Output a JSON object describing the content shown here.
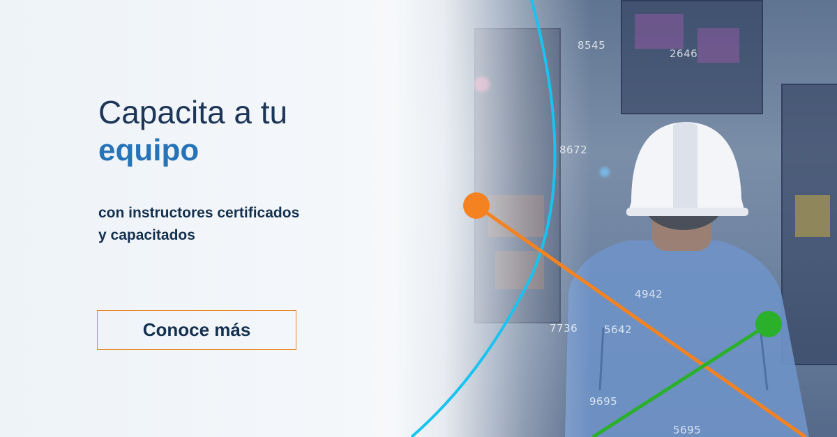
{
  "headline": {
    "line1": "Capacita a tu",
    "line2": "equipo"
  },
  "subheading": {
    "line1": "con instructores certificados",
    "line2": "y capacitados"
  },
  "cta": {
    "label": "Conoce más"
  },
  "photo_numbers": [
    "8545",
    "2646",
    "8672",
    "4942",
    "7736",
    "5642",
    "9695",
    "5695"
  ],
  "colors": {
    "navy": "#14304f",
    "blue": "#2673b8",
    "cyan": "#19c3f0",
    "orange": "#f58220",
    "green": "#2ab02a",
    "cta_border": "#e8892c"
  }
}
